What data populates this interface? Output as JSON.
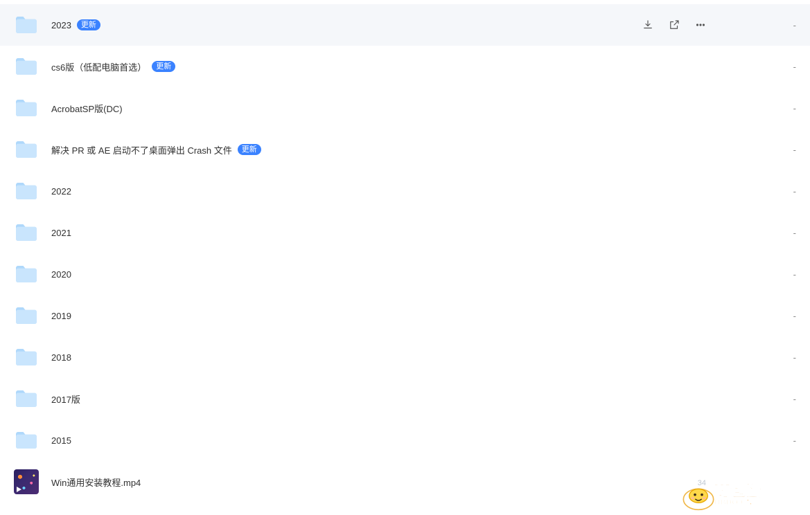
{
  "badge_label": "更新",
  "files": [
    {
      "name": "2023",
      "type": "folder",
      "badge": true,
      "size": "-",
      "hovered": true
    },
    {
      "name": "cs6版（低配电脑首选）",
      "type": "folder",
      "badge": true,
      "size": "-"
    },
    {
      "name": "AcrobatSP版(DC)",
      "type": "folder",
      "badge": false,
      "size": "-"
    },
    {
      "name": "解决 PR 或 AE 启动不了桌面弹出 Crash 文件",
      "type": "folder",
      "badge": true,
      "size": "-"
    },
    {
      "name": "2022",
      "type": "folder",
      "badge": false,
      "size": "-"
    },
    {
      "name": "2021",
      "type": "folder",
      "badge": false,
      "size": "-"
    },
    {
      "name": "2020",
      "type": "folder",
      "badge": false,
      "size": "-"
    },
    {
      "name": "2019",
      "type": "folder",
      "badge": false,
      "size": "-"
    },
    {
      "name": "2018",
      "type": "folder",
      "badge": false,
      "size": "-"
    },
    {
      "name": "2017版",
      "type": "folder",
      "badge": false,
      "size": "-"
    },
    {
      "name": "2015",
      "type": "folder",
      "badge": false,
      "size": "-"
    },
    {
      "name": "Win通用安装教程.mp4",
      "type": "video",
      "badge": false,
      "size": ""
    }
  ],
  "watermark": {
    "cn": "荷包蛋",
    "en": "HBDO.CN",
    "hint": "34"
  }
}
